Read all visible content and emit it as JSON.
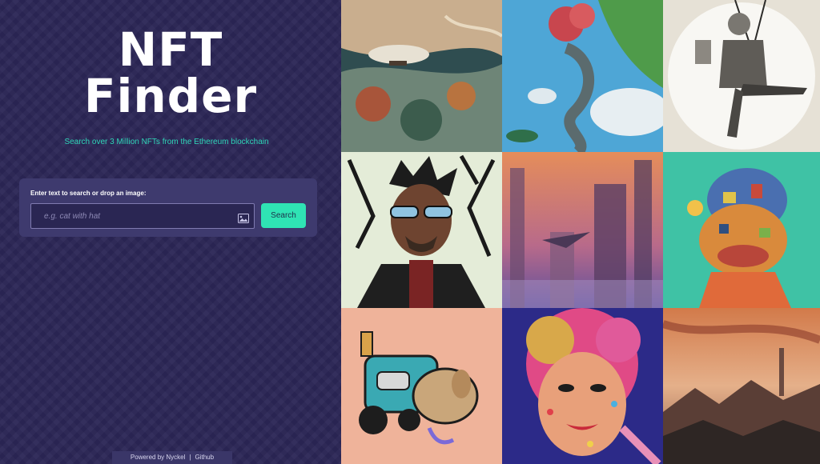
{
  "header": {
    "title_line1": "NFT",
    "title_line2": "Finder",
    "subtitle": "Search over 3 Million NFTs from the Ethereum blockchain"
  },
  "search": {
    "label": "Enter text to search or drop an image:",
    "placeholder": "e.g. cat with hat",
    "value": "",
    "button_label": "Search",
    "image_icon": "image-icon"
  },
  "footer": {
    "powered_by": "Powered by Nyckel",
    "separator": "|",
    "github_link": "Github"
  },
  "gallery": {
    "tiles": [
      {
        "name": "nft-airship-landscape",
        "palette": [
          "#1f3a3c",
          "#c9a27b",
          "#6b8a7f"
        ]
      },
      {
        "name": "nft-floating-island",
        "palette": [
          "#4aa6d8",
          "#c94a4f",
          "#8fd08a"
        ]
      },
      {
        "name": "nft-sketch-swing",
        "palette": [
          "#f4f2ee",
          "#6c6a66",
          "#2e2d2b"
        ]
      },
      {
        "name": "nft-sunglasses-character",
        "palette": [
          "#e6efd9",
          "#5a3a2c",
          "#1c1c1c"
        ]
      },
      {
        "name": "nft-cyber-city",
        "palette": [
          "#e0895b",
          "#6a4f8a",
          "#c76a7c"
        ]
      },
      {
        "name": "nft-colorful-ape",
        "palette": [
          "#3fc4a6",
          "#e08a3a",
          "#4b6fb0"
        ]
      },
      {
        "name": "nft-dog-cart",
        "palette": [
          "#efb39a",
          "#3aa6b0",
          "#c9a87a"
        ]
      },
      {
        "name": "nft-pop-art-woman",
        "palette": [
          "#2d2a8a",
          "#e2407a",
          "#e8c46a"
        ]
      },
      {
        "name": "nft-sunset-mountains",
        "palette": [
          "#d08a5c",
          "#7a4a3a",
          "#2a2624"
        ]
      }
    ]
  }
}
